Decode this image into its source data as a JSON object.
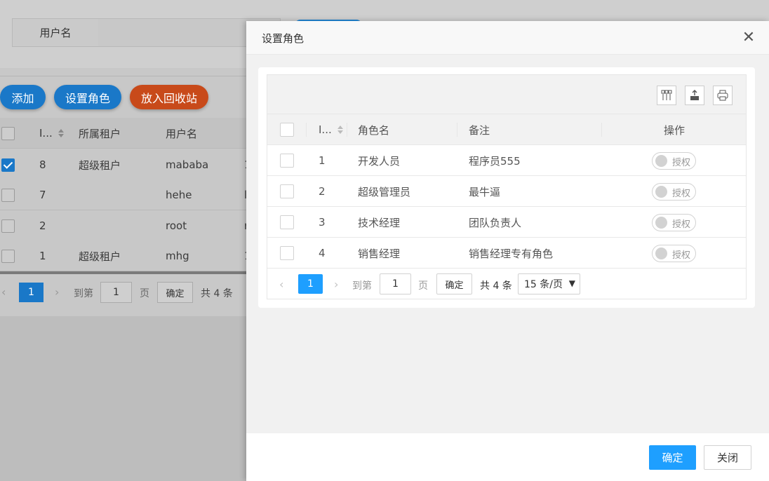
{
  "background": {
    "search_label": "用户名",
    "buttons": {
      "add": "添加",
      "set_role": "设置角色",
      "recycle": "放入回收站"
    },
    "table": {
      "columns": [
        "I...",
        "所属租户",
        "用户名"
      ],
      "rows": [
        {
          "id": "8",
          "tenant": "超级租户",
          "username": "mababa",
          "extra": "1",
          "checked": true
        },
        {
          "id": "7",
          "tenant": "",
          "username": "hehe",
          "extra": "l",
          "checked": false
        },
        {
          "id": "2",
          "tenant": "",
          "username": "root",
          "extra": "r",
          "checked": false
        },
        {
          "id": "1",
          "tenant": "超级租户",
          "username": "mhg",
          "extra": "1",
          "checked": false
        }
      ]
    },
    "pager": {
      "current": "1",
      "goto_label": "到第",
      "goto_value": "1",
      "page_label": "页",
      "confirm": "确定",
      "total": "共 4 条"
    }
  },
  "modal": {
    "title": "设置角色",
    "table": {
      "columns": {
        "id": "I...",
        "role_name": "角色名",
        "remark": "备注",
        "action": "操作"
      },
      "rows": [
        {
          "id": "1",
          "role_name": "开发人员",
          "remark": "程序员555",
          "action": "授权"
        },
        {
          "id": "2",
          "role_name": "超级管理员",
          "remark": "最牛逼",
          "action": "授权"
        },
        {
          "id": "3",
          "role_name": "技术经理",
          "remark": "团队负责人",
          "action": "授权"
        },
        {
          "id": "4",
          "role_name": "销售经理",
          "remark": "销售经理专有角色",
          "action": "授权"
        }
      ]
    },
    "pager": {
      "current": "1",
      "goto_label": "到第",
      "goto_value": "1",
      "page_label": "页",
      "confirm": "确定",
      "total": "共 4 条",
      "page_size": "15 条/页"
    },
    "footer": {
      "confirm": "确定",
      "close": "关闭"
    },
    "colors": {
      "primary": "#1e9fff"
    }
  }
}
